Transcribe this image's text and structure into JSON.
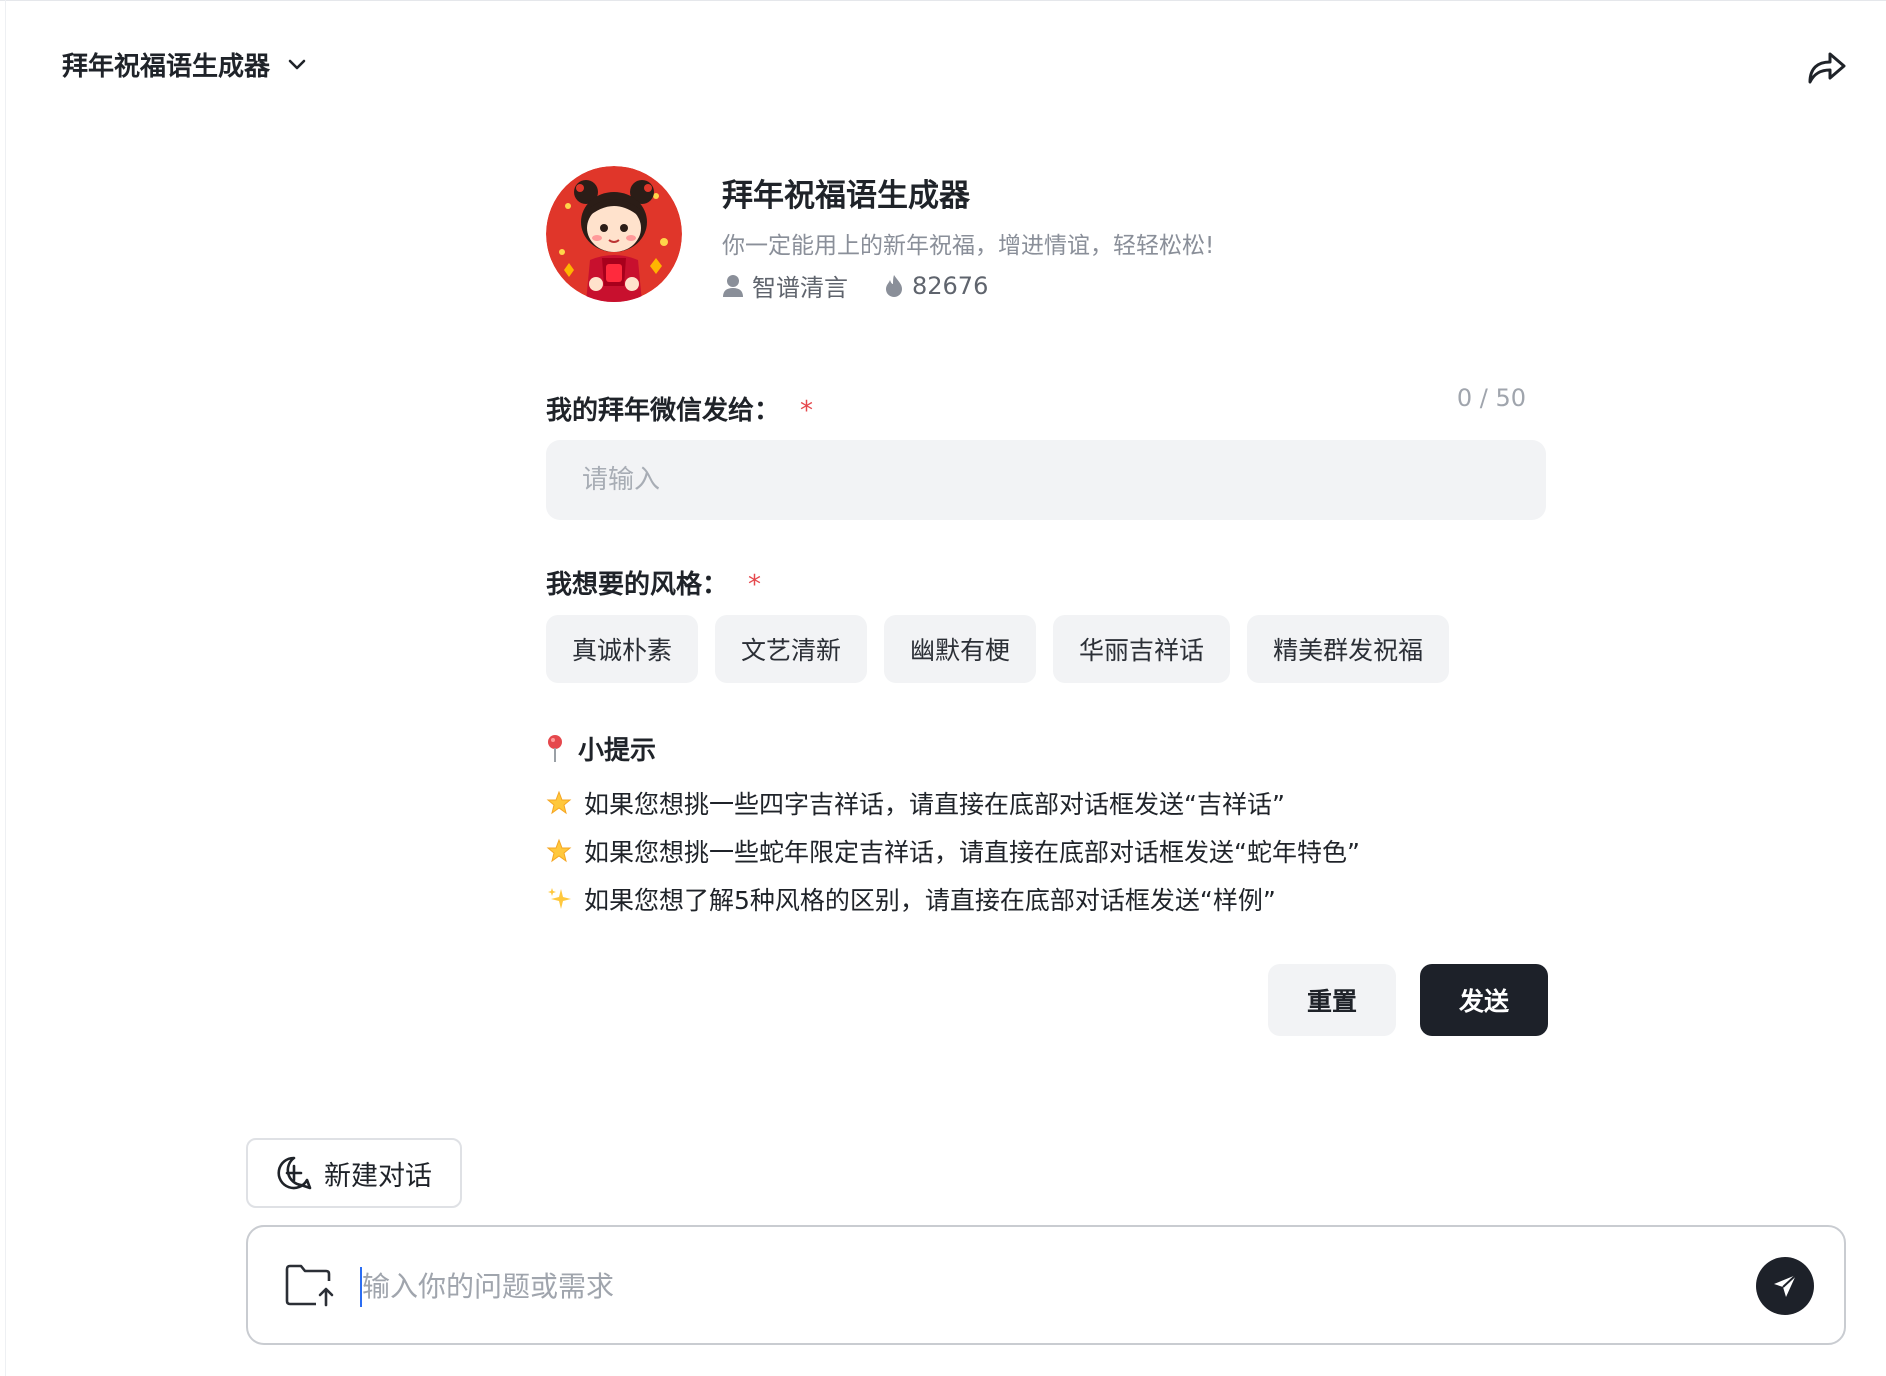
{
  "header": {
    "title": "拜年祝福语生成器"
  },
  "bot": {
    "name": "拜年祝福语生成器",
    "description": "你一定能用上的新年祝福，增进情谊，轻轻松松!",
    "author": "智谱清言",
    "popularity": "82676"
  },
  "form": {
    "recipient_label": "我的拜年微信发给：",
    "required_mark": "*",
    "counter": "0 / 50",
    "recipient_placeholder": "请输入",
    "style_label": "我想要的风格：",
    "styles": [
      "真诚朴素",
      "文艺清新",
      "幽默有梗",
      "华丽吉祥话",
      "精美群发祝福"
    ]
  },
  "tips": {
    "title": "小提示",
    "items": [
      "如果您想挑一些四字吉祥话，请直接在底部对话框发送“吉祥话”",
      "如果您想挑一些蛇年限定吉祥话，请直接在底部对话框发送“蛇年特色”",
      "如果您想了解5种风格的区别，请直接在底部对话框发送“样例”"
    ]
  },
  "actions": {
    "reset": "重置",
    "send": "发送"
  },
  "chat": {
    "new_chat": "新建对话",
    "placeholder": "输入你的问题或需求"
  },
  "colors": {
    "accent_dark": "#1d2129",
    "required": "#e5484d",
    "avatar_bg": "#e0362a"
  }
}
